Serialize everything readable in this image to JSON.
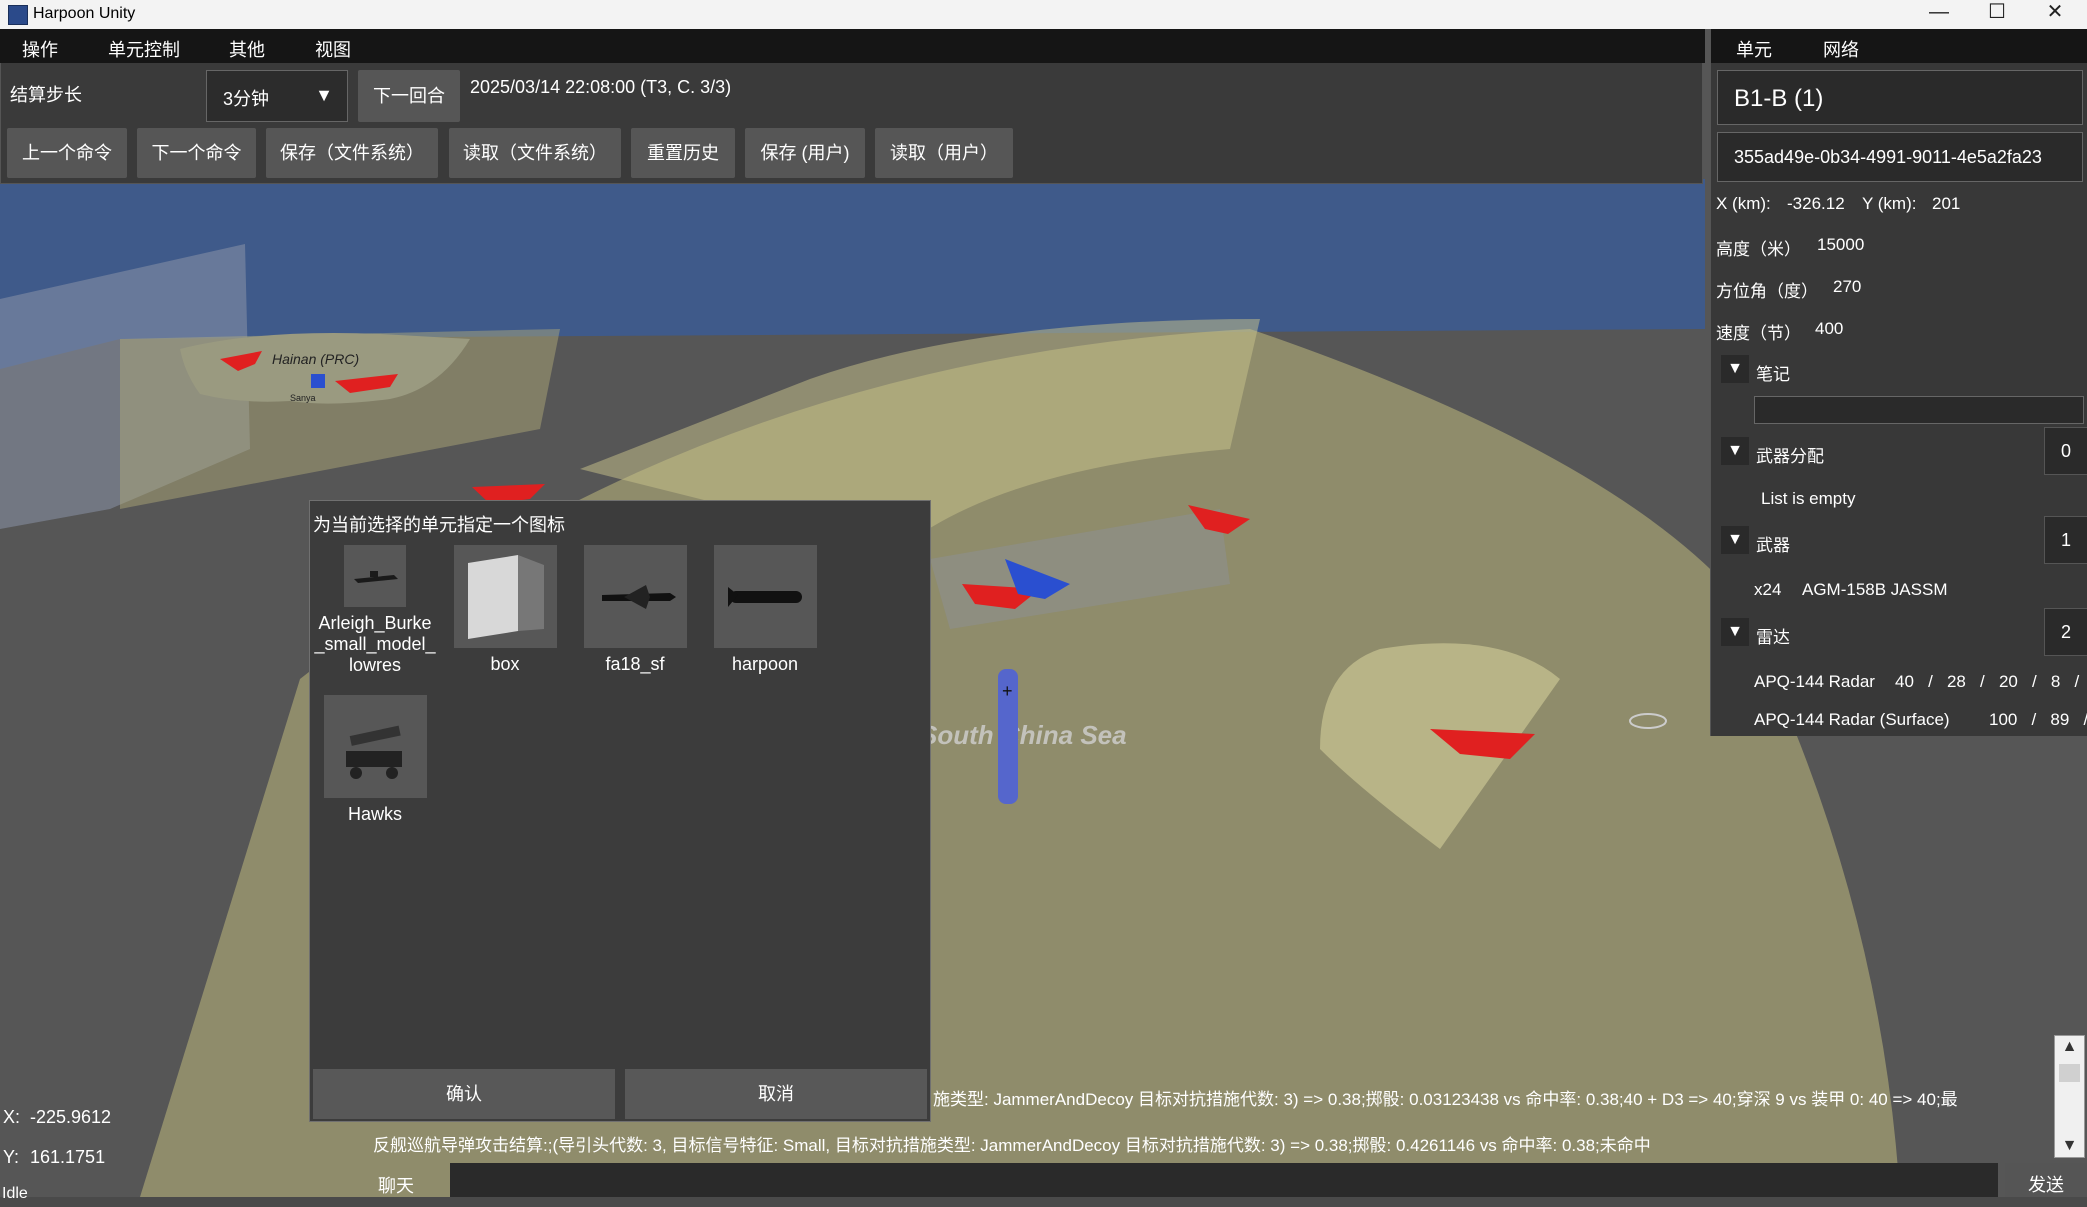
{
  "window": {
    "title": "Harpoon Unity",
    "minimize": "—",
    "maximize": "☐",
    "close": "✕"
  },
  "menu": {
    "items": [
      "操作",
      "单元控制",
      "其他",
      "视图"
    ]
  },
  "toolbar": {
    "step_label": "结算步长",
    "step_value": "3分钟",
    "dropdown_arrow": "▼",
    "next_turn": "下一回合",
    "datetime": "2025/03/14 22:08:00 (T3, C. 3/3)",
    "buttons": [
      "上一个命令",
      "下一个命令",
      "保存（文件系统）",
      "读取（文件系统）",
      "重置历史",
      "保存 (用户)",
      "读取（用户）"
    ]
  },
  "map": {
    "island_label": "Hainan (PRC)",
    "small_label": "Sanya",
    "sea_label": "South China Sea",
    "colors": {
      "sea": "#3f5a8a",
      "land": "#5c5c5c",
      "range": "#b5b079",
      "friendly": "#2a4fd0",
      "enemy": "#e02020"
    }
  },
  "right_panel": {
    "tabs": [
      "单元",
      "网络"
    ],
    "unit_name": "B1-B (1)",
    "unit_id": "355ad49e-0b34-4991-9011-4e5a2fa23",
    "x_label": "X (km):",
    "x_value": "-326.12",
    "y_label": "Y (km):",
    "y_value": "201",
    "altitude_label": "高度（米）",
    "altitude_value": "15000",
    "heading_label": "方位角（度）",
    "heading_value": "270",
    "speed_label": "速度（节）",
    "speed_value": "400",
    "expand_glyph": "▼",
    "notes_label": "笔记",
    "notes_value": "",
    "weapon_assign_label": "武器分配",
    "weapon_assign_count": "0",
    "weapon_assign_empty": "List is empty",
    "weapons_label": "武器",
    "weapons_count": "1",
    "weapons_items": [
      {
        "qty": "x24",
        "name": "AGM-158B JASSM"
      }
    ],
    "radar_label": "雷达",
    "radar_count": "2",
    "radar_items": [
      {
        "name": "APQ-144 Radar",
        "vals": "40   /   28   /   20   /   8   /"
      },
      {
        "name": "APQ-144 Radar (Surface)",
        "vals": "100   /   89   /"
      }
    ]
  },
  "dialog": {
    "title": "为当前选择的单元指定一个图标",
    "icons": [
      {
        "name": "Arleigh_Burke_small_model_lowres",
        "lines": [
          "Arleigh_Burke",
          "_small_model_",
          "lowres"
        ]
      },
      {
        "name": "box",
        "lines": [
          "box"
        ]
      },
      {
        "name": "fa18_sf",
        "lines": [
          "fa18_sf"
        ]
      },
      {
        "name": "harpoon",
        "lines": [
          "harpoon"
        ]
      },
      {
        "name": "Hawks",
        "lines": [
          "Hawks"
        ]
      }
    ],
    "confirm": "确认",
    "cancel": "取消"
  },
  "cursor": {
    "x_label": "X:",
    "x_value": "-225.9612",
    "y_label": "Y:",
    "y_value": "161.1751"
  },
  "log": {
    "line1": "施类型: JammerAndDecoy 目标对抗措施代数: 3) => 0.38;掷骰: 0.03123438 vs 命中率: 0.38;40 + D3 => 40;穿深 9 vs 装甲 0: 40 => 40;最",
    "line2": "反舰巡航导弹攻击结算:;(导引头代数: 3, 目标信号特征: Small, 目标对抗措施类型: JammerAndDecoy 目标对抗措施代数: 3) => 0.38;掷骰: 0.4261146 vs 命中率: 0.38;未命中"
  },
  "chat": {
    "label": "聊天",
    "send": "发送",
    "value": ""
  },
  "status": {
    "text": "Idle"
  }
}
